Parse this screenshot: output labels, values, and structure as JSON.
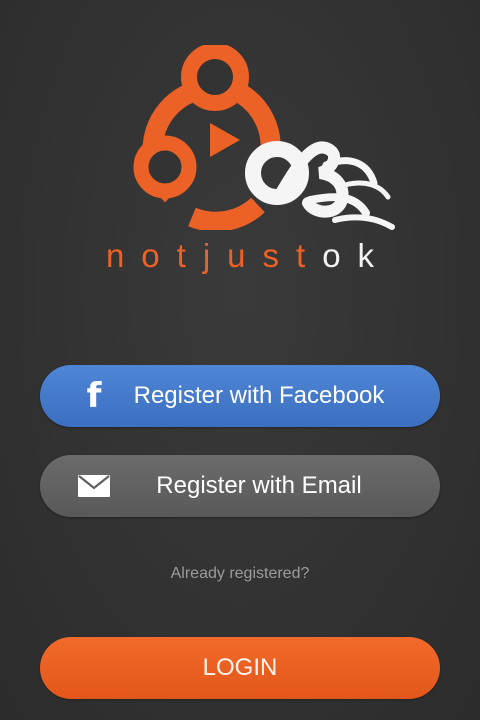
{
  "app": {
    "brand_part1": "notjus",
    "brand_part2": "t",
    "brand_part3": "ok"
  },
  "actions": {
    "facebook_label": "Register with Facebook",
    "email_label": "Register with Email",
    "already_label": "Already registered?",
    "login_label": "LOGIN"
  },
  "icons": {
    "facebook": "facebook-icon",
    "email": "envelope-icon",
    "logo": "play-logo-icon"
  },
  "colors": {
    "accent_orange": "#ec6125",
    "facebook_blue": "#4a7fd0",
    "email_gray": "#626262",
    "background": "#333333"
  }
}
